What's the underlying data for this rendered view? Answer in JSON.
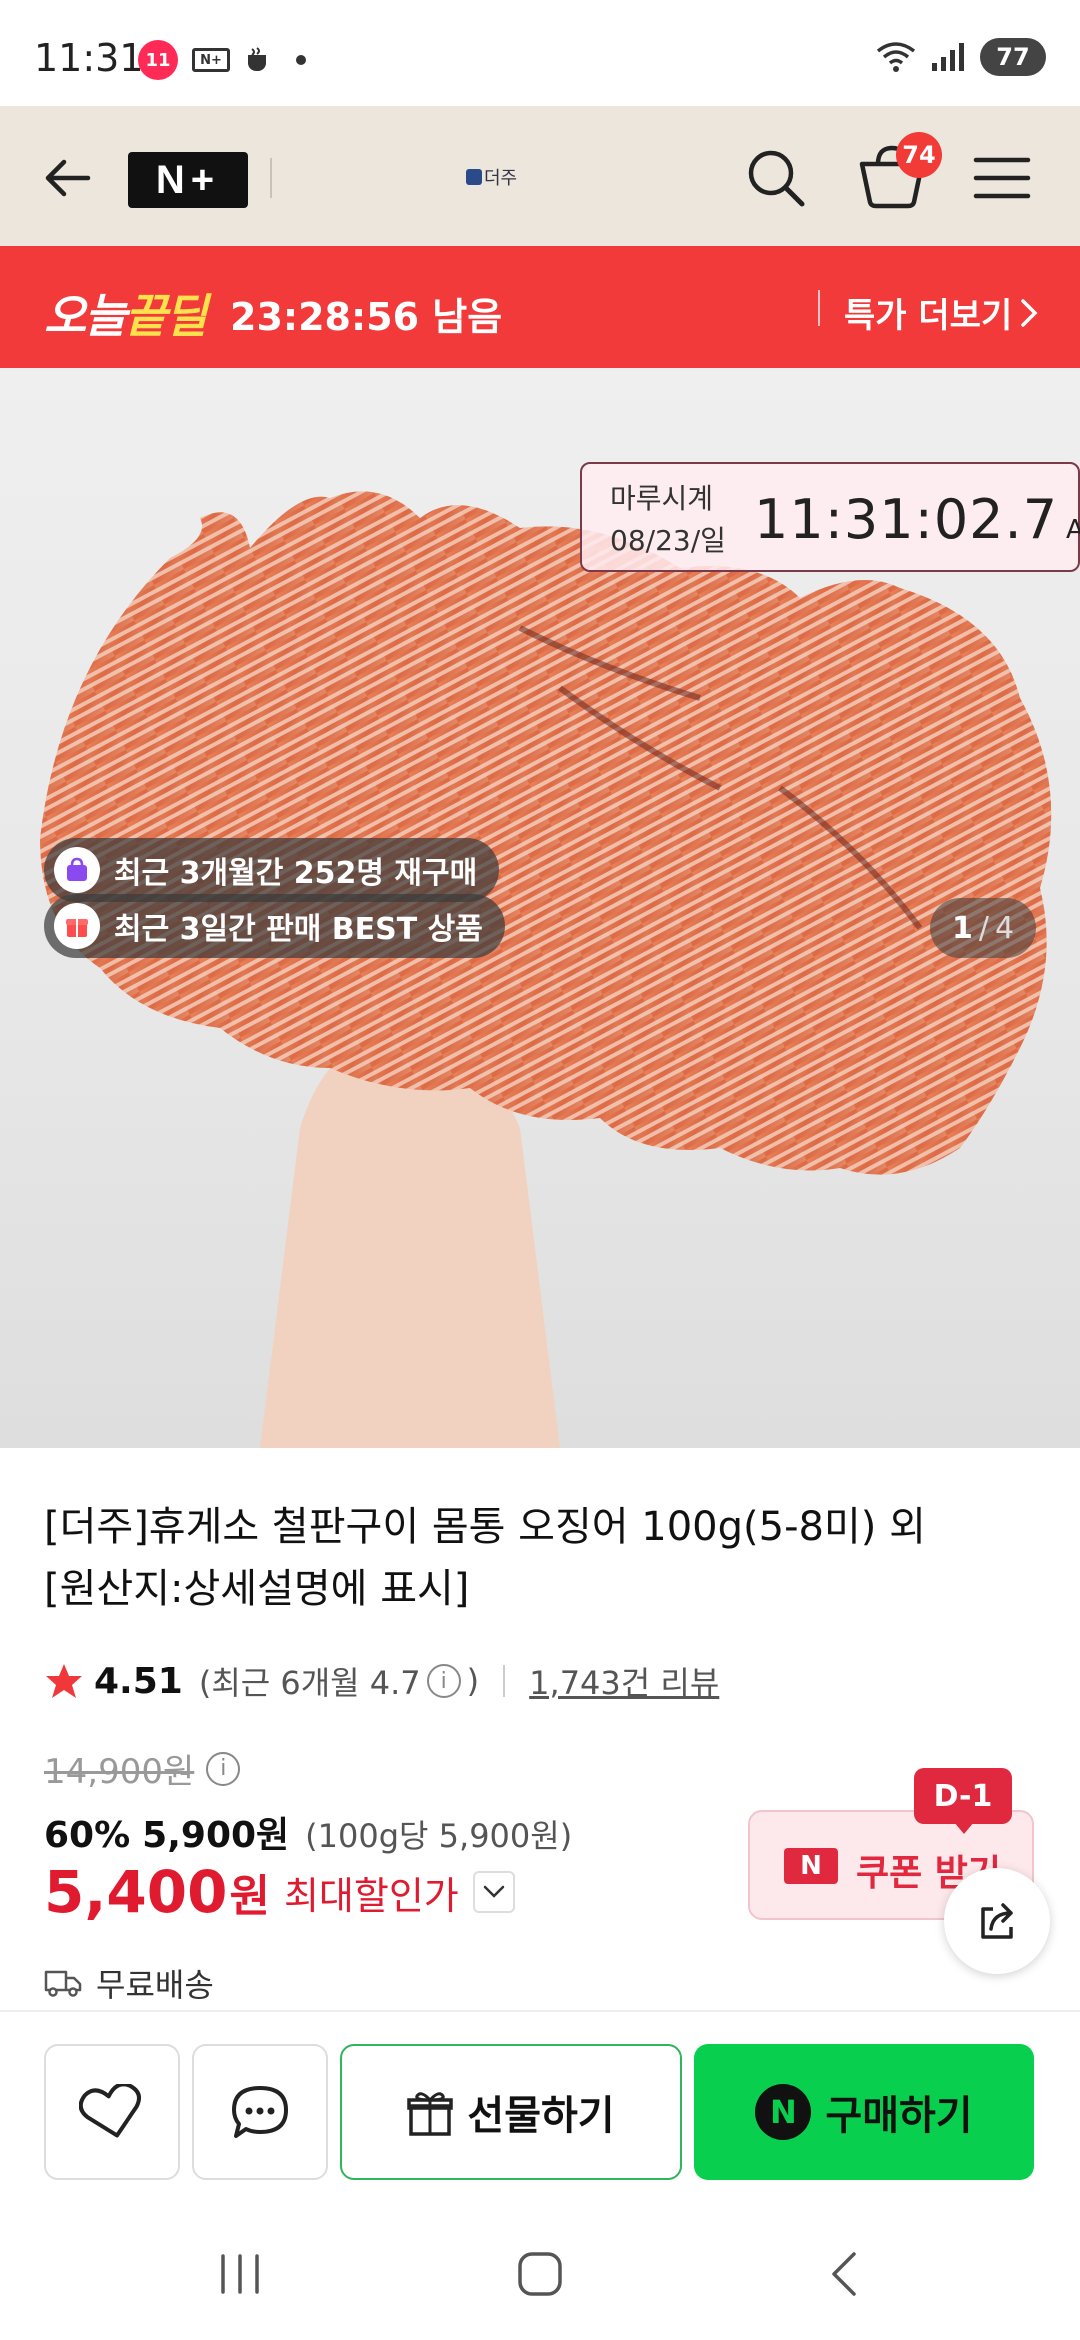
{
  "status_bar": {
    "time": "11:31",
    "app_badge": "11",
    "battery": "77"
  },
  "header": {
    "brand_left": "N+",
    "store_logo": "더주",
    "cart_count": "74"
  },
  "deal_bar": {
    "logo_part1": "오늘",
    "logo_part2": "끝딜",
    "countdown": "23:28:56 남음",
    "more": "특가 더보기"
  },
  "hero": {
    "clock": {
      "label_line1": "마루시계",
      "label_line2": "08/23/일",
      "time": "11:31:02.7",
      "ampm": "AM"
    },
    "badges": [
      {
        "text": "최근 3개월간 252명 재구매"
      },
      {
        "text": "최근 3일간 판매 BEST 상품"
      }
    ],
    "pager": {
      "current": "1",
      "total": "4"
    }
  },
  "product": {
    "title_line1": "[더주]휴게소 철판구이 몸통 오징어 100g(5-8미) 외",
    "title_line2": "[원산지:상세설명에 표시]",
    "rating": "4.51",
    "recent_rating_prefix": "(최근 6개월 4.7",
    "recent_rating_suffix": ")",
    "reviews": "1,743건 리뷰",
    "original_price": "14,900원",
    "discount_rate": "60%",
    "sale_price": "5,900원",
    "unit_price": "(100g당 5,900원)",
    "max_discount_price": "5,400",
    "max_discount_won": "원",
    "max_discount_label": "최대할인가",
    "shipping": "무료배송"
  },
  "coupon": {
    "dday": "D-1",
    "n_mark": "N",
    "label": "쿠폰 받기"
  },
  "action_bar": {
    "gift_label": "선물하기",
    "buy_mark": "N",
    "buy_label": "구매하기"
  },
  "colors": {
    "header_bg": "#ece6dc",
    "deal_red": "#f23a3a",
    "price_red": "#e01b30",
    "buy_green": "#08d04e"
  }
}
